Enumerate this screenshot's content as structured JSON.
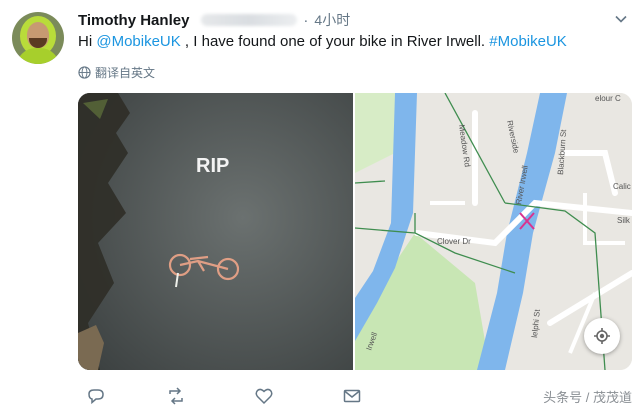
{
  "tweet": {
    "author_name": "Timothy Hanley",
    "separator": "·",
    "time": "4小时",
    "text": {
      "prefix": "Hi ",
      "mention": "@MobikeUK",
      "body": " , I have found one of your bike in River Irwell. ",
      "hashtag": "#MobikeUK"
    },
    "translate_label": "翻译自英文"
  },
  "media": {
    "photo_caption": "RIP",
    "map": {
      "labels": [
        "Meadow Rd",
        "Riverside",
        "River Irwell",
        "Blackburn St",
        "Clover Dr",
        "lelphi St",
        "Irwell",
        "Calic",
        "Silk",
        "elour C"
      ],
      "marker": "X"
    }
  },
  "colors": {
    "link": "#1b95e0",
    "river": "#7fb6ec",
    "park": "#c8e6b4"
  },
  "icons": [
    "reply-icon",
    "retweet-icon",
    "like-icon",
    "mail-icon",
    "chevron-down-icon",
    "globe-icon",
    "my-location-icon"
  ],
  "watermark": "头条号 / 茂茂道"
}
